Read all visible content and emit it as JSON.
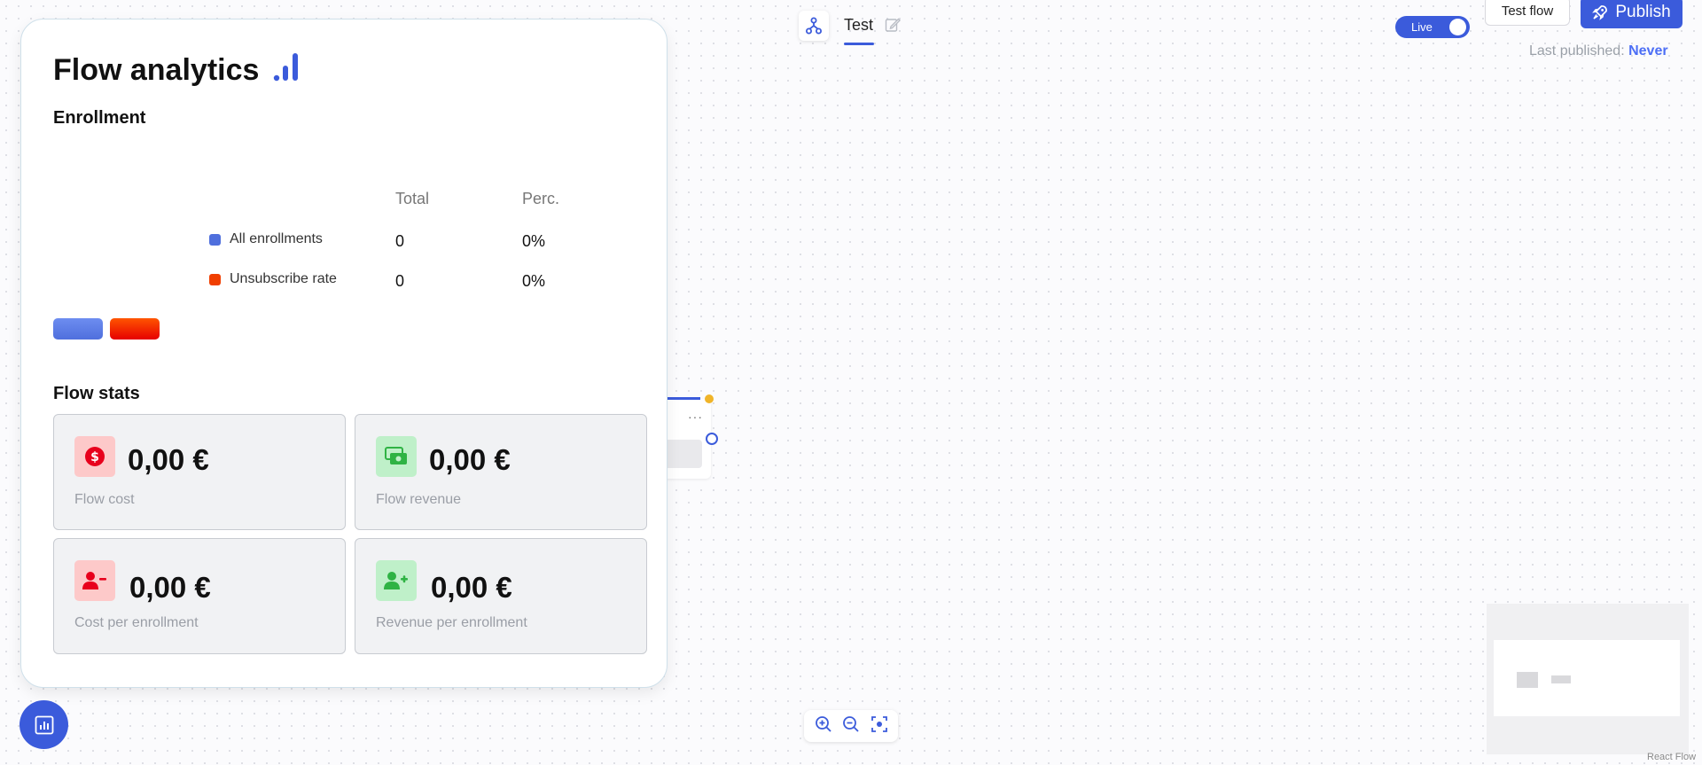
{
  "header": {
    "flow_name": "Test",
    "live_label": "Live",
    "test_flow_label": "Test flow",
    "publish_label": "Publish",
    "last_published_label": "Last published:",
    "last_published_value": "Never"
  },
  "panel": {
    "title": "Flow analytics",
    "enrollment_heading": "Enrollment",
    "columns": {
      "total": "Total",
      "perc": "Perc."
    },
    "rows": [
      {
        "label": "All enrollments",
        "total": "0",
        "perc": "0%",
        "color": "#4f6fdd"
      },
      {
        "label": "Unsubscribe rate",
        "total": "0",
        "perc": "0%",
        "color": "#f03e00"
      }
    ],
    "stats_heading": "Flow stats",
    "stats": [
      {
        "value": "0,00 €",
        "label": "Flow cost",
        "icon": "dollar-coin-icon",
        "tone": "red"
      },
      {
        "value": "0,00 €",
        "label": "Flow revenue",
        "icon": "cash-icon",
        "tone": "green"
      },
      {
        "value": "0,00 €",
        "label": "Cost per enrollment",
        "icon": "user-minus-icon",
        "tone": "red"
      },
      {
        "value": "0,00 €",
        "label": "Revenue per enrollment",
        "icon": "user-plus-icon",
        "tone": "green"
      }
    ]
  },
  "canvas": {
    "node_menu_label": "···",
    "attribution": "React Flow"
  },
  "colors": {
    "accent": "#3b5bdb",
    "panel_border": "#cfe0ea",
    "red_tile": "#fdc9c9",
    "green_tile": "#bff0c9"
  }
}
